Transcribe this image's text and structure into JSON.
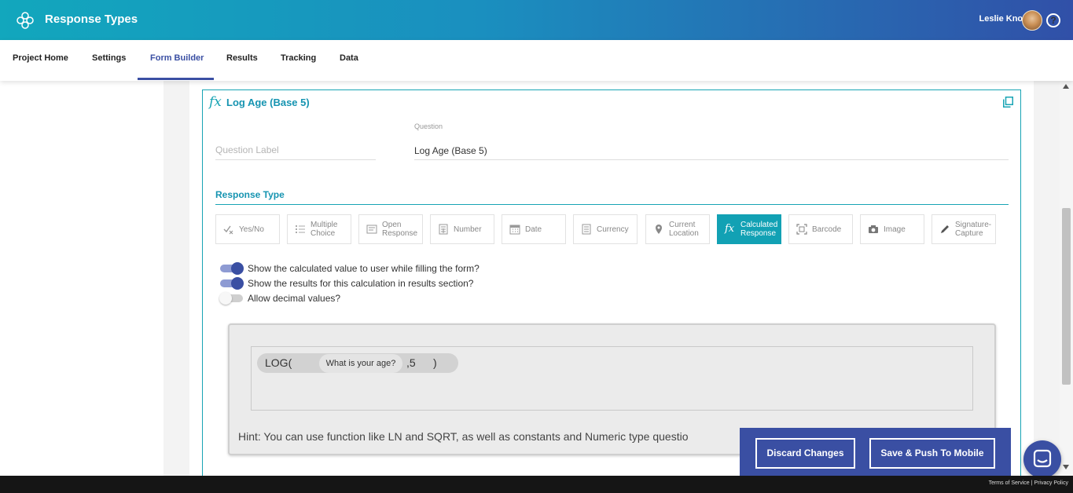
{
  "header": {
    "title": "Response Types",
    "user_name": "Leslie Knope",
    "help_glyph": "?",
    "icons": [
      "app-logo-icon",
      "avatar",
      "help-icon"
    ]
  },
  "nav": {
    "tabs": [
      {
        "label": "Project Home",
        "active": false
      },
      {
        "label": "Settings",
        "active": false
      },
      {
        "label": "Form Builder",
        "active": true
      },
      {
        "label": "Results",
        "active": false
      },
      {
        "label": "Tracking",
        "active": false
      },
      {
        "label": "Data",
        "active": false
      }
    ]
  },
  "question_card": {
    "fx_glyph": "fx",
    "title": "Log Age (Base 5)",
    "label_placeholder": "Question Label",
    "question_caption": "Question",
    "question_value": "Log Age (Base 5)"
  },
  "response_type": {
    "heading": "Response Type",
    "options": [
      {
        "label": "Yes/No",
        "icon": "yes-no-icon",
        "active": false
      },
      {
        "label": "Multiple Choice",
        "icon": "list-icon",
        "active": false
      },
      {
        "label": "Open Response",
        "icon": "text-box-icon",
        "active": false
      },
      {
        "label": "Number",
        "icon": "calculator-icon",
        "active": false
      },
      {
        "label": "Date",
        "icon": "calendar-icon",
        "active": false
      },
      {
        "label": "Currency",
        "icon": "currency-icon",
        "active": false
      },
      {
        "label": "Current Location",
        "icon": "location-pin-icon",
        "active": false
      },
      {
        "label": "Calculated Response",
        "icon": "fx-icon",
        "active": true
      },
      {
        "label": "Barcode",
        "icon": "barcode-icon",
        "active": false
      },
      {
        "label": "Image",
        "icon": "camera-icon",
        "active": false
      },
      {
        "label": "Signature-Capture",
        "icon": "pen-icon",
        "active": false
      }
    ]
  },
  "toggles": [
    {
      "label": "Show the calculated value to user while filling the form?",
      "on": true
    },
    {
      "label": "Show the results for this calculation in results section?",
      "on": true
    },
    {
      "label": "Allow decimal values?",
      "on": false
    }
  ],
  "formula": {
    "function": "LOG(",
    "token": "What is your age?",
    "argument": ",5",
    "close": ")"
  },
  "hint": "Hint: You can use function like LN and SQRT, as well as constants and Numeric type questio",
  "actions": {
    "discard": "Discard Changes",
    "save": "Save & Push To Mobile"
  },
  "footer": {
    "terms": "Terms of Service",
    "separator": "|",
    "privacy": "Privacy Policy"
  },
  "colors": {
    "header_gradient_start": "#12a7bd",
    "header_gradient_end": "#3150a8",
    "accent_teal": "#18a4b4",
    "primary_blue": "#3a4fa3"
  }
}
